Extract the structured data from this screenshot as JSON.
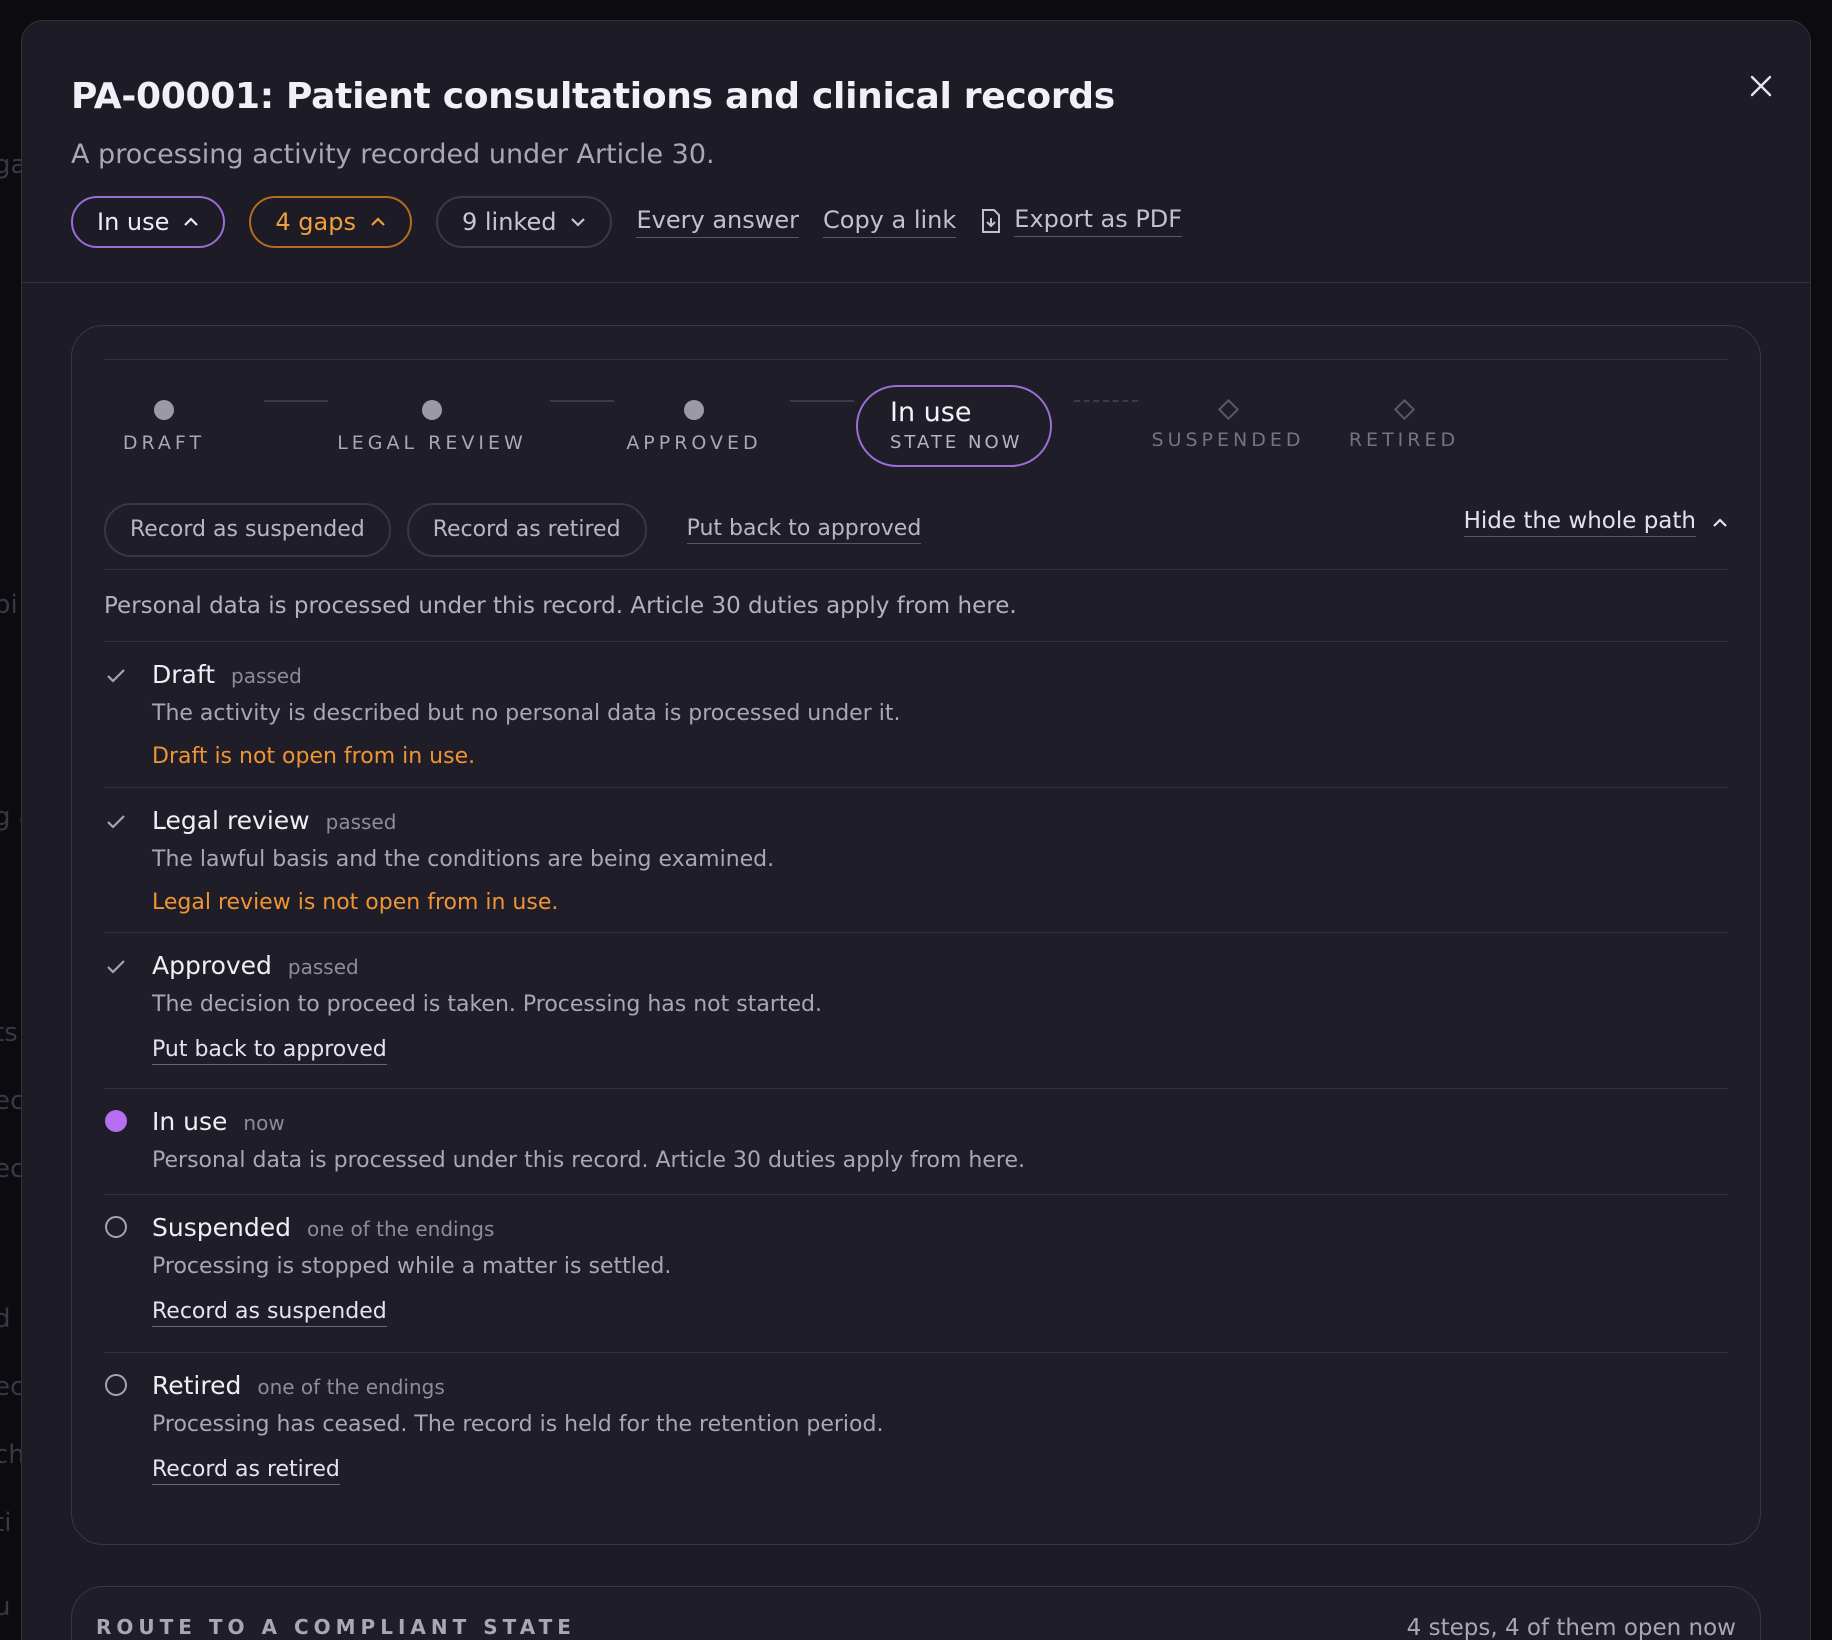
{
  "background": {
    "fragments": [
      "ga",
      "pi",
      "g a",
      "ts",
      "ec",
      "ec",
      "d r",
      "ec",
      "ch",
      "ti",
      "u"
    ]
  },
  "modal": {
    "title": "PA-00001: Patient consultations and clinical records",
    "subtitle": "A processing activity recorded under Article 30.",
    "toolbar": {
      "status_label": "In use",
      "gaps_label": "4 gaps",
      "linked_label": "9 linked",
      "every_answer": "Every answer",
      "copy_link": "Copy a link",
      "export_pdf": "Export as PDF"
    }
  },
  "stepper": {
    "steps": [
      {
        "label": "DRAFT",
        "kind": "dot"
      },
      {
        "label": "LEGAL REVIEW",
        "kind": "dot"
      },
      {
        "label": "APPROVED",
        "kind": "dot"
      },
      {
        "label": "SUSPENDED",
        "kind": "diamond"
      },
      {
        "label": "RETIRED",
        "kind": "diamond"
      }
    ],
    "current": {
      "name": "In use",
      "sub": "STATE NOW"
    }
  },
  "actions": {
    "record_suspended": "Record as suspended",
    "record_retired": "Record as retired",
    "put_back": "Put back to approved",
    "hide_path": "Hide the whole path"
  },
  "summary": "Personal data is processed under this record. Article 30 duties apply from here.",
  "states": [
    {
      "name": "Draft",
      "tag": "passed",
      "desc": "The activity is described but no personal data is processed under it.",
      "warn": "Draft is not open from in use."
    },
    {
      "name": "Legal review",
      "tag": "passed",
      "desc": "The lawful basis and the conditions are being examined.",
      "warn": "Legal review is not open from in use."
    },
    {
      "name": "Approved",
      "tag": "passed",
      "desc": "The decision to proceed is taken. Processing has not started.",
      "link": "Put back to approved"
    },
    {
      "name": "In use",
      "tag": "now",
      "desc": "Personal data is processed under this record. Article 30 duties apply from here."
    },
    {
      "name": "Suspended",
      "tag": "one of the endings",
      "desc": "Processing is stopped while a matter is settled.",
      "link": "Record as suspended"
    },
    {
      "name": "Retired",
      "tag": "one of the endings",
      "desc": "Processing has ceased. The record is held for the retention period.",
      "link": "Record as retired"
    }
  ],
  "route": {
    "title": "ROUTE TO A COMPLIANT STATE",
    "count": "4 steps, 4 of them open now"
  },
  "colors": {
    "accent_purple": "#9a6ed6",
    "current_dot": "#b86ef0",
    "warning_orange": "#ef9433",
    "surface": "#1d1b25"
  }
}
